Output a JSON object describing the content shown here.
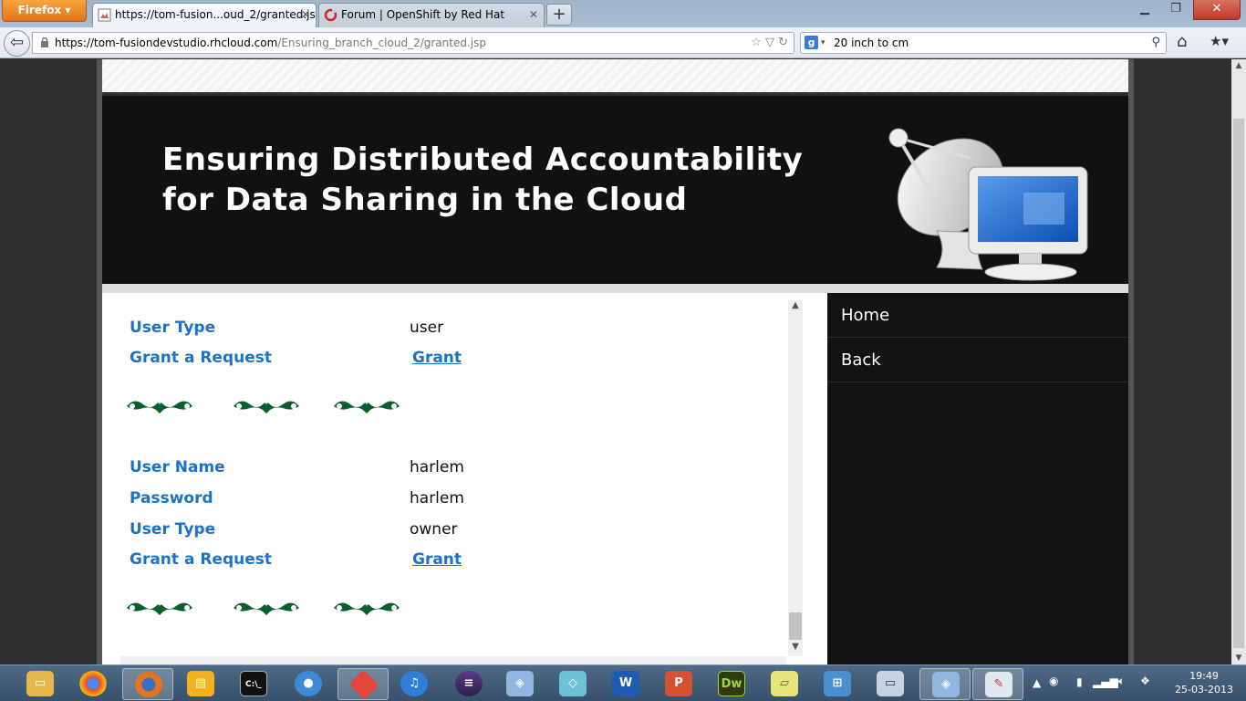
{
  "browser": {
    "menu_button": "Firefox",
    "tabs": [
      {
        "title": "https://tom-fusion...oud_2/granted.jsp",
        "active": true
      },
      {
        "title": "Forum | OpenShift by Red Hat",
        "active": false
      }
    ],
    "url_domain": "https://tom-fusiondevstudio.rhcloud.com",
    "url_path": "/Ensuring_branch_cloud_2/granted.jsp",
    "search_value": "20 inch to cm"
  },
  "page": {
    "banner_title_line1": "Ensuring Distributed Accountability",
    "banner_title_line2": "for Data Sharing in the Cloud",
    "records": [
      {
        "fields": [
          {
            "label": "User Type",
            "value": "user"
          },
          {
            "label": "Grant a Request",
            "link": "Grant"
          }
        ]
      },
      {
        "fields": [
          {
            "label": "User Name",
            "value": "harlem"
          },
          {
            "label": "Password",
            "value": "harlem"
          },
          {
            "label": "User Type",
            "value": "owner"
          },
          {
            "label": "Grant a Request",
            "link": "Grant"
          }
        ]
      }
    ],
    "nav": [
      {
        "label": "Home"
      },
      {
        "label": "Back"
      }
    ]
  },
  "taskbar": {
    "apps": [
      "explorer",
      "chrome",
      "firefox",
      "files",
      "cmd",
      "app-blue",
      "git",
      "itunes",
      "eclipse",
      "virtualbox",
      "gadget",
      "word",
      "powerpoint",
      "dreamweaver",
      "sticky-notes",
      "control-panel",
      "monitor",
      "virtualbox-2",
      "paint"
    ],
    "time": "19:49",
    "date": "25-03-2013"
  },
  "colors": {
    "accent_link": "#1a72c9",
    "banner_bg": "#111111",
    "nav_bg": "#121212",
    "ornament": "#0b5e2c"
  }
}
